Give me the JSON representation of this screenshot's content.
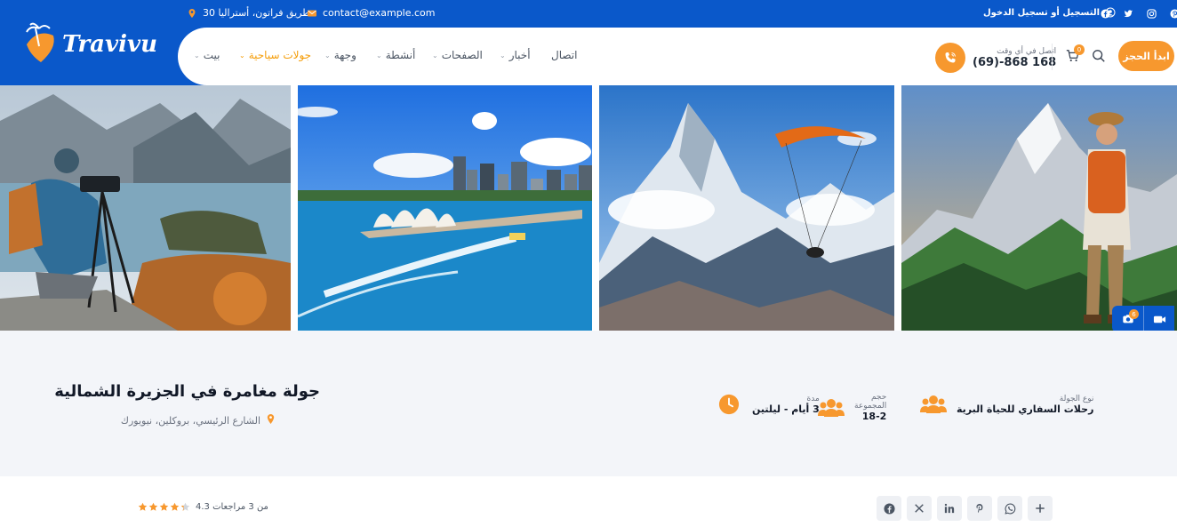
{
  "brand": {
    "logo_text": "Travivu",
    "primary_color": "#0a58ca",
    "accent_color": "#f7982e"
  },
  "topbar": {
    "address": "طريق فراتون، أستراليا 30",
    "email": "contact@example.com",
    "login": "التسجيل أو تسجيل الدخول",
    "social_icons": [
      "facebook-icon",
      "twitter-icon",
      "instagram-icon",
      "pinterest-icon"
    ]
  },
  "nav": {
    "items": [
      {
        "label": "بيت",
        "chevron": true
      },
      {
        "label": "جولات سياحية",
        "chevron": true,
        "active": true
      },
      {
        "label": "وجهة",
        "chevron": true
      },
      {
        "label": "أنشطة",
        "chevron": true
      },
      {
        "label": "الصفحات",
        "chevron": true
      },
      {
        "label": "أخبار",
        "chevron": true
      },
      {
        "label": "اتصال",
        "chevron": false
      }
    ]
  },
  "header_actions": {
    "call_label": "اتصل في أي وقت",
    "call_number": "(69)-868 168",
    "cart_count": "0",
    "book_button": "ابدأ الحجز"
  },
  "gallery": {
    "images": [
      "photographer-lake",
      "sydney-opera-house",
      "paraglider-mountains",
      "hiker-mountains"
    ],
    "photo_count": "6"
  },
  "tour": {
    "title": "جولة مغامرة في الجزيرة الشمالية",
    "location": "الشارع الرئيسي، بروكلين، نيويورك",
    "facts": [
      {
        "label": "نوع الجولة",
        "value": "رحلات السفاري للحياة البرية",
        "icon": "users-icon"
      },
      {
        "label": "حجم المجموعة",
        "value": "18-2",
        "icon": "group-icon"
      },
      {
        "label": "مدة",
        "value": "3 أيام - ليلتين",
        "icon": "clock-icon"
      }
    ]
  },
  "rating": {
    "text": "من 3 مراجعات 4.3",
    "stars": 4.3
  },
  "share": {
    "icons": [
      "plus-icon",
      "whatsapp-icon",
      "pinterest-icon",
      "linkedin-icon",
      "x-icon",
      "facebook-icon"
    ]
  }
}
